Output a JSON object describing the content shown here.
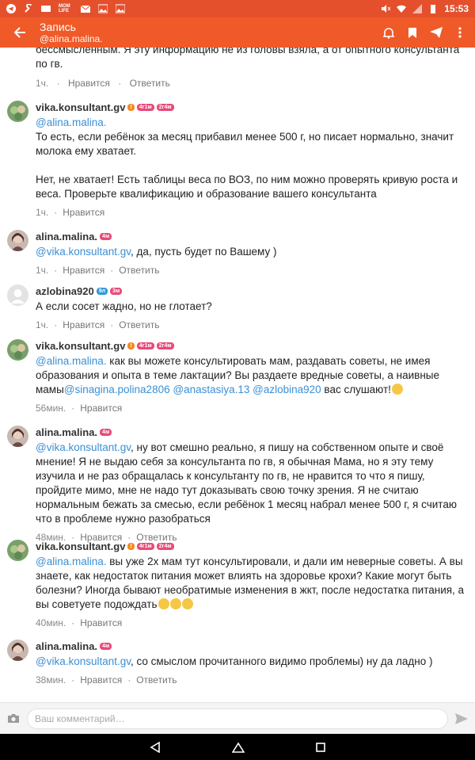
{
  "status_bar": {
    "time": "15:53",
    "carrier_label": "MOM LIFE"
  },
  "app_bar": {
    "title": "Запись",
    "subtitle": "@alina.malina."
  },
  "partial_comment": {
    "text": "бессмысленным. Я эту информацию не из головы взяла, а от опытного консультанта по гв.",
    "time": "1ч.",
    "like": "Нравится",
    "reply": "Ответить"
  },
  "comments": [
    {
      "user": "vika.konsultant.gv",
      "badges": [
        "!",
        "4г1м",
        "2г4м"
      ],
      "mention": "@alina.malina.",
      "text1": "То есть, если ребёнок за месяц прибавил менее 500 г, но писает нормально, значит молока ему хватает.",
      "text2": "Нет, не хватает! Есть таблицы веса по ВОЗ, по ним можно проверять кривую роста и веса. Проверьте квалификацию и образование вашего консультанта",
      "time": "1ч.",
      "like": "Нравится"
    },
    {
      "user": "alina.malina.",
      "badges": [
        "4м"
      ],
      "mention": "@vika.konsultant.gv",
      "text": ", да, пусть будет по Вашему )",
      "time": "1ч.",
      "like": "Нравится",
      "reply": "Ответить"
    },
    {
      "user": "azlobina920",
      "badges": [
        "9л",
        "3м"
      ],
      "text": "А если сосет жадно, но не глотает?",
      "time": "1ч.",
      "like": "Нравится",
      "reply": "Ответить"
    },
    {
      "user": "vika.konsultant.gv",
      "badges": [
        "!",
        "4г1м",
        "2г4м"
      ],
      "mention": "@alina.malina.",
      "text": " как вы можете консультировать мам, раздавать советы, не имея образования и опыта в теме лактации? Вы раздаете вредные советы, а наивные мамы",
      "m1": "@sinagina.polina2806",
      "m2": "@anastasiya.13",
      "m3": "@azlobina920",
      "tail": " вас слушают!",
      "time": "56мин.",
      "like": "Нравится"
    },
    {
      "user": "alina.malina.",
      "badges": [
        "4м"
      ],
      "mention": "@vika.konsultant.gv",
      "text": ", ну вот смешно реально, я пишу на собственном опыте и своё мнение! Я не выдаю себя за консультанта по гв, я обычная Мама, но я эту тему изучила и не раз обращалась к консультанту по гв, не нравится то что я пишу, пройдите мимо, мне не надо тут доказывать свою точку зрения. Я не считаю нормальным бежать за смесью, если ребёнок 1 месяц набрал менее 500 г, я считаю что в проблеме нужно разобраться",
      "time": "48мин.",
      "like": "Нравится",
      "reply": "Ответить"
    },
    {
      "user": "vika.konsultant.gv",
      "badges": [
        "!",
        "4г1м",
        "2г4м"
      ],
      "mention": "@alina.malina.",
      "text": " вы уже 2х мам тут консультировали, и дали им неверные советы. А вы знаете, как недостаток питания может влиять на здоровье крохи? Какие могут быть болезни? Иногда бывают необратимые изменения в жкт, после недостатка питания, а вы советуете подождать",
      "time": "40мин.",
      "like": "Нравится"
    },
    {
      "user": "alina.malina.",
      "badges": [
        "4м"
      ],
      "mention": "@vika.konsultant.gv",
      "text": ", со смыслом прочитанного видимо проблемы) ну да ладно )",
      "time": "38мин.",
      "like": "Нравится",
      "reply": "Ответить"
    }
  ],
  "input": {
    "placeholder": "Ваш комментарий…"
  },
  "colors": {
    "accent": "#f05a28",
    "mention": "#3b8fd6"
  }
}
